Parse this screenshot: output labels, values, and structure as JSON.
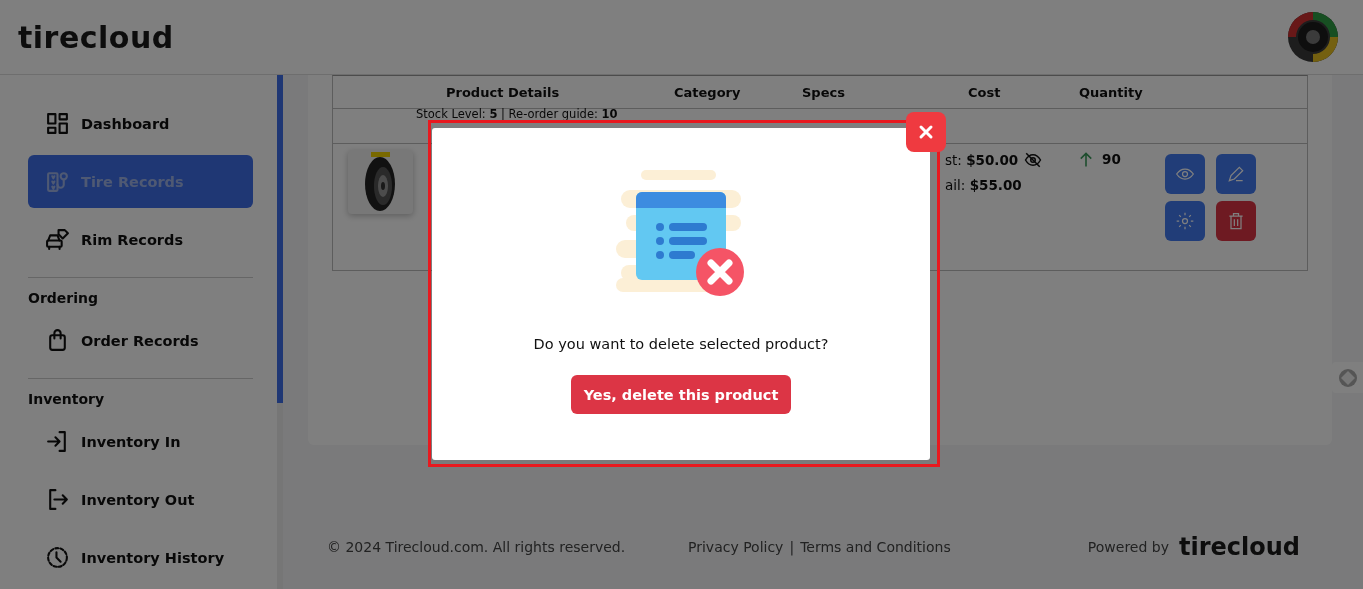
{
  "header": {
    "logo": "tirecloud"
  },
  "sidebar": {
    "sections": [
      {
        "items": [
          {
            "label": "Dashboard",
            "selected": false
          },
          {
            "label": "Tire Records",
            "selected": true
          },
          {
            "label": "Rim Records",
            "selected": false
          }
        ]
      },
      {
        "title": "Ordering",
        "items": [
          {
            "label": "Order Records",
            "selected": false
          }
        ]
      },
      {
        "title": "Inventory",
        "items": [
          {
            "label": "Inventory In",
            "selected": false
          },
          {
            "label": "Inventory Out",
            "selected": false
          },
          {
            "label": "Inventory History",
            "selected": false
          }
        ]
      }
    ]
  },
  "table": {
    "columns": [
      "Product Details",
      "Category",
      "Specs",
      "Cost",
      "Quantity"
    ],
    "rows": [
      {
        "stock_line": "Stock Level: **5** | Re-order guide: **10**"
      },
      {
        "cost": "st: **$50.00**",
        "retail": "ail: **$55.00**",
        "quantity": "90"
      }
    ]
  },
  "modal": {
    "message": "Do you want to delete selected product?",
    "confirm_button": "Yes, delete this product"
  },
  "footer": {
    "copyright": "© 2024 Tirecloud.com. All rights reserved.",
    "links": [
      "Privacy Policy",
      "Terms and Conditions"
    ],
    "separator": "|",
    "powered_by": "Powered by",
    "logo": "tirecloud"
  }
}
